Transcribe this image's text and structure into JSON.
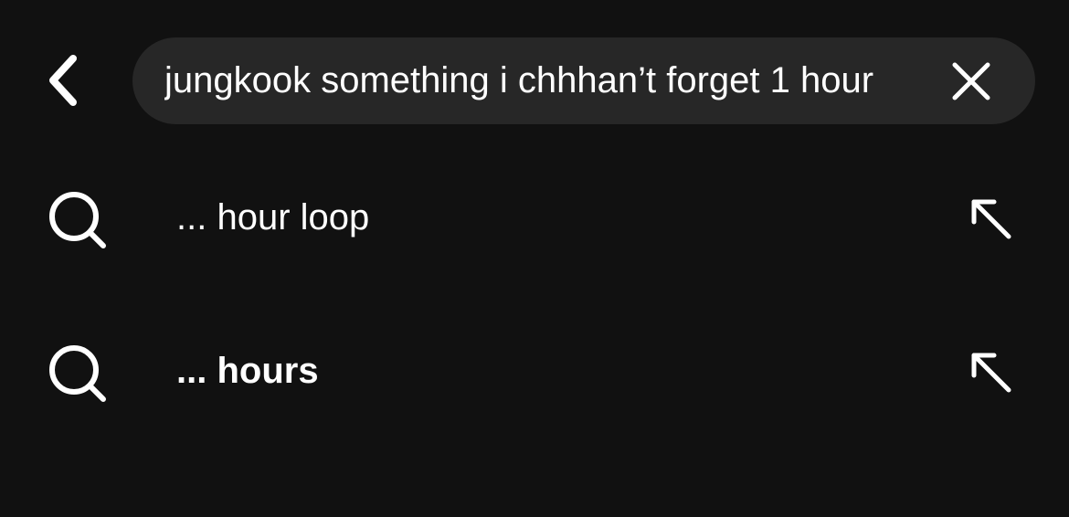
{
  "search": {
    "query": "jungkook something i chhhan’t forget 1 hour"
  },
  "suggestions": [
    {
      "text": "... hour loop",
      "bold": false
    },
    {
      "text": "... hours",
      "bold": true
    }
  ],
  "icons": {
    "back": "chevron-left-icon",
    "clear": "close-icon",
    "search": "search-icon",
    "fill_query": "arrow-up-left-icon"
  },
  "colors": {
    "background": "#111111",
    "search_bar": "#272727",
    "text": "#ffffff"
  }
}
